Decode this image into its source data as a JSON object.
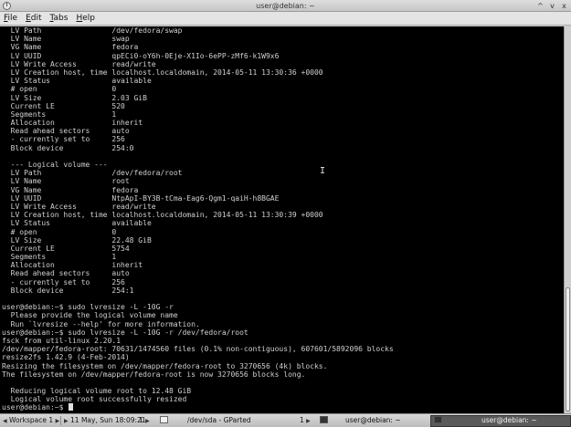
{
  "window": {
    "title": "user@debian: ~",
    "controls": [
      "^",
      "v",
      "x"
    ]
  },
  "menu": [
    {
      "label": "File",
      "mnemonic": "F",
      "rest": "ile"
    },
    {
      "label": "Edit",
      "mnemonic": "E",
      "rest": "dit"
    },
    {
      "label": "Tabs",
      "mnemonic": "T",
      "rest": "abs"
    },
    {
      "label": "Help",
      "mnemonic": "H",
      "rest": "elp"
    }
  ],
  "terminal": {
    "lines": [
      "  LV Path                /dev/fedora/swap",
      "  LV Name                swap",
      "  VG Name                fedora",
      "  LV UUID                qpECi0-oY6h-0Eje-X1Io-6ePP-zMf6-k1W9x6",
      "  LV Write Access        read/write",
      "  LV Creation host, time localhost.localdomain, 2014-05-11 13:30:36 +0000",
      "  LV Status              available",
      "  # open                 0",
      "  LV Size                2.03 GiB",
      "  Current LE             520",
      "  Segments               1",
      "  Allocation             inherit",
      "  Read ahead sectors     auto",
      "  - currently set to     256",
      "  Block device           254:0",
      "",
      "  --- Logical volume ---",
      "  LV Path                /dev/fedora/root",
      "  LV Name                root",
      "  VG Name                fedora",
      "  LV UUID                NtpApI-BY3B-tCma-Eag6-Qgm1-qaiH-h8BGAE",
      "  LV Write Access        read/write",
      "  LV Creation host, time localhost.localdomain, 2014-05-11 13:30:39 +0000",
      "  LV Status              available",
      "  # open                 0",
      "  LV Size                22.48 GiB",
      "  Current LE             5754",
      "  Segments               1",
      "  Allocation             inherit",
      "  Read ahead sectors     auto",
      "  - currently set to     256",
      "  Block device           254:1",
      "",
      "user@debian:~$ sudo lvresize -L -10G -r",
      "  Please provide the logical volume name",
      "  Run `lvresize --help' for more information.",
      "user@debian:~$ sudo lvresize -L -10G -r /dev/fedora/root",
      "fsck from util-linux 2.20.1",
      "/dev/mapper/fedora-root: 70631/1474560 files (0.1% non-contiguous), 607601/5892096 blocks",
      "resize2fs 1.42.9 (4-Feb-2014)",
      "Resizing the filesystem on /dev/mapper/fedora-root to 3270656 (4k) blocks.",
      "The filesystem on /dev/mapper/fedora-root is now 3270656 blocks long.",
      "",
      "  Reducing logical volume root to 12.48 GiB",
      "  Logical volume root successfully resized"
    ],
    "prompt": "user@debian:~$ "
  },
  "taskbar": {
    "workspace": "Workspace 1",
    "clock": "11 May, Sun 18:09:21",
    "task_count_1": "1",
    "task_gparted": "/dev/sda - GParted",
    "task_count_2": "1",
    "task_terminal_1": "user@debian: ~",
    "task_terminal_2": "user@debian: ~"
  }
}
